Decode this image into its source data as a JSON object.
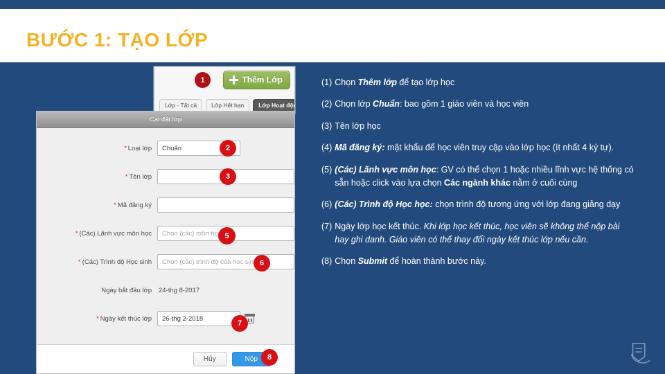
{
  "slide": {
    "title": "BƯỚC 1: TẠO LỚP",
    "accent_gold": "#f0b323",
    "background_blue": "#234a7d"
  },
  "screenshot_toolbar": {
    "add_class_button": "Thêm Lớp",
    "plus_icon": "plus-icon",
    "badge_1": "1",
    "tabs": [
      {
        "label": "Lớp - Tất cả",
        "active": false
      },
      {
        "label": "Lớp Hết hạn",
        "active": false
      },
      {
        "label": "Lớp Hoạt động",
        "active": true
      }
    ]
  },
  "screenshot_form": {
    "header": "Cài đặt lớp",
    "fields": [
      {
        "required": "*",
        "label": "Loại lớp",
        "value": "Chuẩn",
        "kind": "select",
        "badge": "2"
      },
      {
        "required": "*",
        "label": "Tên lớp",
        "value": "",
        "kind": "text",
        "badge": "3"
      },
      {
        "required": "*",
        "label": "Mã đăng ký",
        "value": "",
        "kind": "text",
        "badge": ""
      },
      {
        "required": "*",
        "label": "(Các) Lãnh vực môn học",
        "value": "Chọn (các) môn học",
        "kind": "placeholder",
        "badge": "5"
      },
      {
        "required": "*",
        "label": "(Các) Trình độ Học sinh",
        "value": "Chọn (các) trình độ của học sinh",
        "kind": "placeholder",
        "badge": "6"
      },
      {
        "required": "",
        "label": "Ngày bắt đầu lớp",
        "value": "24-thg 8-2017",
        "kind": "static",
        "badge": ""
      },
      {
        "required": "*",
        "label": "Ngày kết thúc lớp",
        "value": "26-thg 2-2018",
        "kind": "date",
        "badge": "7"
      }
    ],
    "cancel_button": "Hủy",
    "submit_button": "Nộp",
    "submit_badge": "8",
    "calendar_icon": "calendar-icon"
  },
  "notes": [
    {
      "num": "(1)",
      "parts": [
        {
          "t": "Chọn ",
          "s": "plain"
        },
        {
          "t": "Thêm lớp",
          "s": "bold-italic"
        },
        {
          "t": " để tạo lớp học",
          "s": "plain"
        }
      ]
    },
    {
      "num": "(2)",
      "parts": [
        {
          "t": "Chọn lớp ",
          "s": "plain"
        },
        {
          "t": "Chuẩn",
          "s": "bold-italic"
        },
        {
          "t": ": bao gồm 1 giáo viên và học viên",
          "s": "plain"
        }
      ]
    },
    {
      "num": "(3)",
      "parts": [
        {
          "t": "Tên lớp học",
          "s": "plain"
        }
      ]
    },
    {
      "num": "(4)",
      "parts": [
        {
          "t": "Mã đăng ký:",
          "s": "bold-italic"
        },
        {
          "t": " mật khẩu để học viên truy cập vào lớp học (ít nhất 4 ký tự).",
          "s": "plain"
        }
      ]
    },
    {
      "num": "(5)",
      "parts": [
        {
          "t": "(Các) Lãnh vực môn học",
          "s": "bold-italic"
        },
        {
          "t": ": GV có thể chọn 1 hoặc nhiều lĩnh vực hệ thống có sẵn hoặc click vào lựa chọn ",
          "s": "plain"
        },
        {
          "t": "Các ngành khác",
          "s": "bold"
        },
        {
          "t": " nằm ở cuối cùng",
          "s": "plain"
        }
      ]
    },
    {
      "num": "(6)",
      "parts": [
        {
          "t": "(Các) Trình độ Học học:",
          "s": "bold-italic"
        },
        {
          "t": " chọn trình độ tương ứng với lớp đang giảng dạy",
          "s": "plain"
        }
      ]
    },
    {
      "num": "(7)",
      "parts": [
        {
          "t": "Ngày lớp học kết thúc. ",
          "s": "plain"
        },
        {
          "t": "Khi lớp học kết thúc, học viên sẽ không thể nộp bài hay ghi danh. Giáo viên có thể thay đổi ngày kết thúc lớp nếu cần.",
          "s": "italic"
        }
      ]
    },
    {
      "num": "(8)",
      "parts": [
        {
          "t": "Chọn ",
          "s": "plain"
        },
        {
          "t": "Submit",
          "s": "bold-italic"
        },
        {
          "t": " để hoàn thành bước này.",
          "s": "plain"
        }
      ]
    }
  ],
  "corner_logo": "brand-logo-icon"
}
